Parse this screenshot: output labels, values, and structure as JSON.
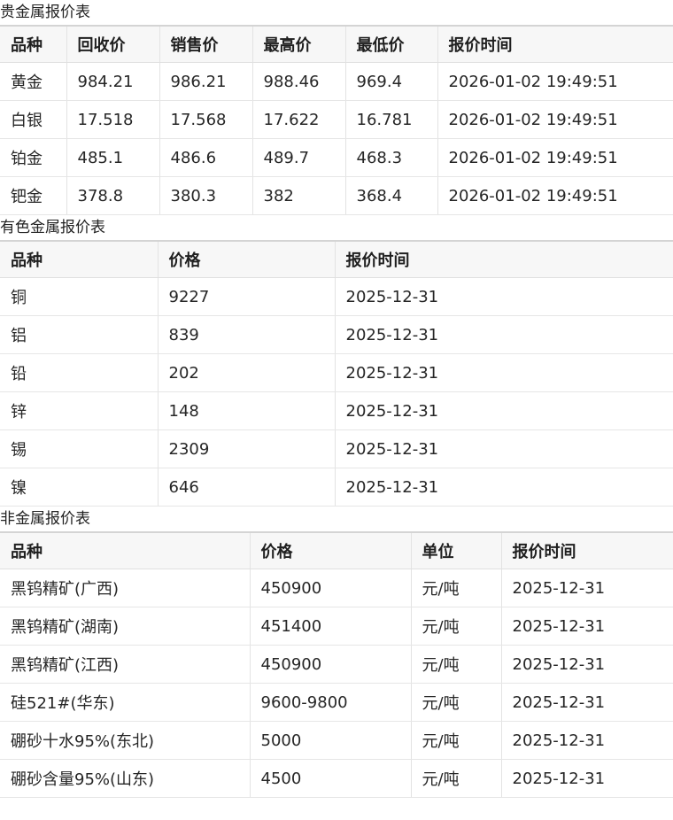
{
  "precious": {
    "title": "贵金属报价表",
    "headers": [
      "品种",
      "回收价",
      "销售价",
      "最高价",
      "最低价",
      "报价时间"
    ],
    "rows": [
      [
        "黄金",
        "984.21",
        "986.21",
        "988.46",
        "969.4",
        "2026-01-02 19:49:51"
      ],
      [
        "白银",
        "17.518",
        "17.568",
        "17.622",
        "16.781",
        "2026-01-02 19:49:51"
      ],
      [
        "铂金",
        "485.1",
        "486.6",
        "489.7",
        "468.3",
        "2026-01-02 19:49:51"
      ],
      [
        "钯金",
        "378.8",
        "380.3",
        "382",
        "368.4",
        "2026-01-02 19:49:51"
      ]
    ]
  },
  "nonferrous": {
    "title": "有色金属报价表",
    "headers": [
      "品种",
      "价格",
      "报价时间"
    ],
    "rows": [
      [
        "铜",
        "9227",
        "2025-12-31"
      ],
      [
        "铝",
        "839",
        "2025-12-31"
      ],
      [
        "铅",
        "202",
        "2025-12-31"
      ],
      [
        "锌",
        "148",
        "2025-12-31"
      ],
      [
        "锡",
        "2309",
        "2025-12-31"
      ],
      [
        "镍",
        "646",
        "2025-12-31"
      ]
    ]
  },
  "nonmetal": {
    "title": "非金属报价表",
    "headers": [
      "品种",
      "价格",
      "单位",
      "报价时间"
    ],
    "rows": [
      [
        "黑钨精矿(广西)",
        "450900",
        "元/吨",
        "2025-12-31"
      ],
      [
        "黑钨精矿(湖南)",
        "451400",
        "元/吨",
        "2025-12-31"
      ],
      [
        "黑钨精矿(江西)",
        "450900",
        "元/吨",
        "2025-12-31"
      ],
      [
        "硅521#(华东)",
        "9600-9800",
        "元/吨",
        "2025-12-31"
      ],
      [
        "硼砂十水95%(东北)",
        "5000",
        "元/吨",
        "2025-12-31"
      ],
      [
        "硼砂含量95%(山东)",
        "4500",
        "元/吨",
        "2025-12-31"
      ]
    ]
  }
}
